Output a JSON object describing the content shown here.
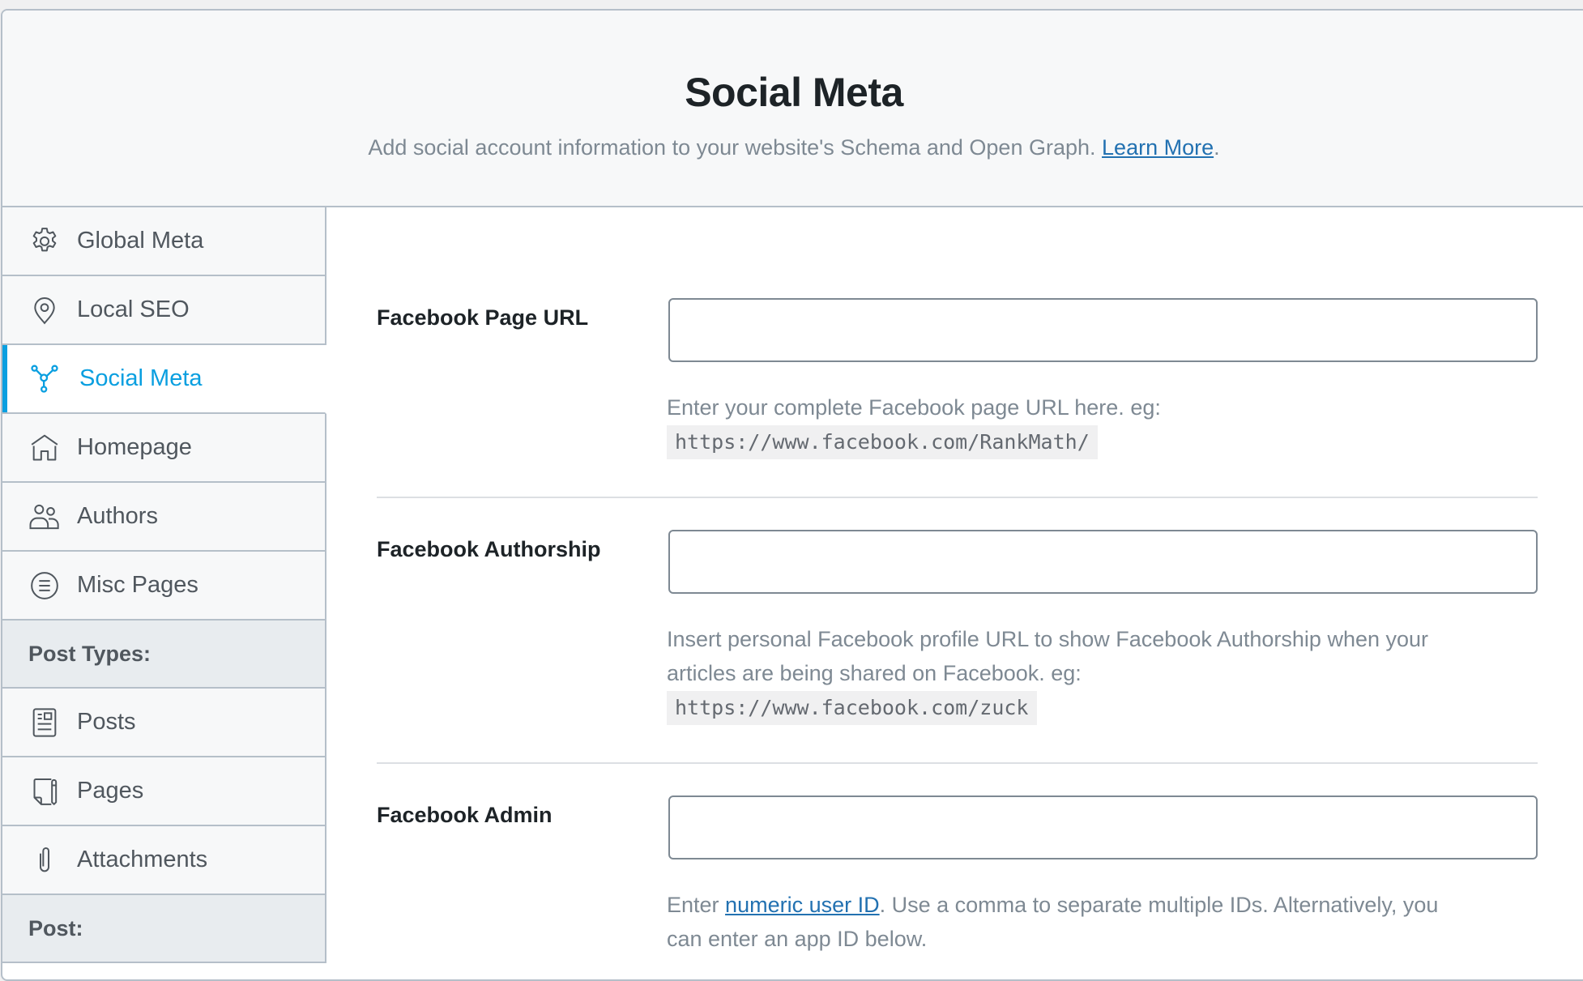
{
  "header": {
    "title": "Social Meta",
    "subtitle": "Add social account information to your website's Schema and Open Graph.",
    "learn_more": "Learn More",
    "period": "."
  },
  "sidebar": {
    "items": [
      {
        "label": "Global Meta",
        "icon": "gear-icon"
      },
      {
        "label": "Local SEO",
        "icon": "map-pin-icon"
      },
      {
        "label": "Social Meta",
        "icon": "share-nodes-icon",
        "active": true
      },
      {
        "label": "Homepage",
        "icon": "home-icon"
      },
      {
        "label": "Authors",
        "icon": "users-icon"
      },
      {
        "label": "Misc Pages",
        "icon": "list-circle-icon"
      }
    ],
    "post_types_heading": "Post Types:",
    "post_types": [
      {
        "label": "Posts",
        "icon": "post-icon"
      },
      {
        "label": "Pages",
        "icon": "page-icon"
      },
      {
        "label": "Attachments",
        "icon": "paperclip-icon"
      }
    ],
    "post_heading": "Post:"
  },
  "fields": [
    {
      "label": "Facebook Page URL",
      "value": "",
      "description": "Enter your complete Facebook page URL here. eg:",
      "code": "https://www.facebook.com/RankMath/"
    },
    {
      "label": "Facebook Authorship",
      "value": "",
      "description_line1": "Insert personal Facebook profile URL to show Facebook Authorship when your",
      "description_line2": "articles are being shared on Facebook. eg:",
      "code": "https://www.facebook.com/zuck"
    },
    {
      "label": "Facebook Admin",
      "value": "",
      "description_prefix": "Enter ",
      "description_link": "numeric user ID",
      "description_suffix": ". Use a comma to separate multiple IDs. Alternatively, you",
      "description_line2": "can enter an app ID below."
    }
  ],
  "colors": {
    "accent": "#0a9fe0",
    "link": "#2271b1",
    "text": "#1d2327",
    "muted": "#7e8993"
  }
}
